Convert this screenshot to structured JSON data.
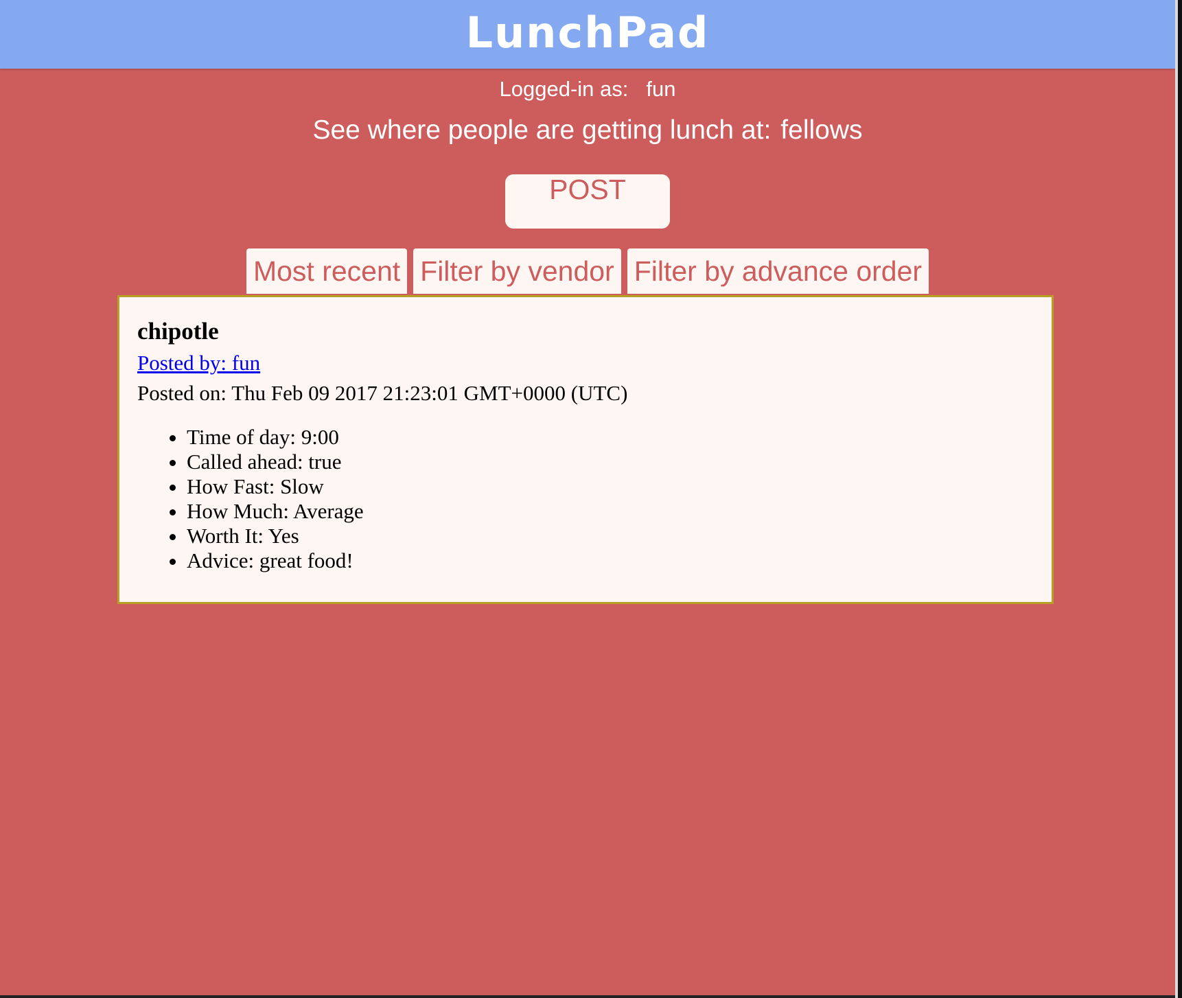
{
  "app": {
    "title": "LunchPad"
  },
  "user_bar": {
    "logged_in_label": "Logged-in as:",
    "username": "fun"
  },
  "headline": {
    "text": "See where people are getting lunch at:",
    "group": "fellows"
  },
  "post_button": {
    "label": "POST"
  },
  "tabs": [
    {
      "label": "Most recent"
    },
    {
      "label": "Filter by vendor"
    },
    {
      "label": "Filter by advance order"
    }
  ],
  "post": {
    "vendor": "chipotle",
    "posted_by": "Posted by: fun",
    "posted_on": "Posted on: Thu Feb 09 2017 21:23:01 GMT+0000 (UTC)",
    "details": [
      "Time of day: 9:00",
      "Called ahead: true",
      "How Fast: Slow",
      "How Much: Average",
      "Worth It: Yes",
      "Advice: great food!"
    ]
  },
  "colors": {
    "header": "#84a9f0",
    "background": "#cd5d5d",
    "card": "#fdf6f2",
    "card_border": "#b8a024",
    "link": "#0000ee"
  }
}
